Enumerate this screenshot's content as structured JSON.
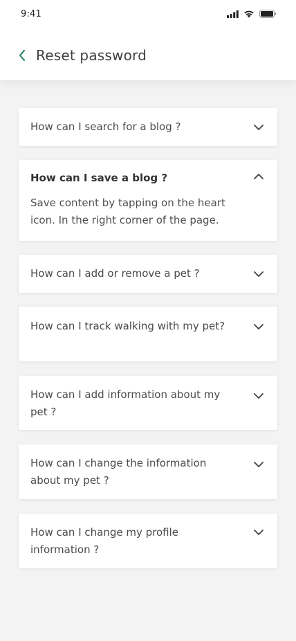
{
  "status_bar": {
    "time": "9:41",
    "icons": [
      "cellular-signal-icon",
      "wifi-icon",
      "battery-icon"
    ]
  },
  "header": {
    "back_icon": "chevron-left-icon",
    "title": "Reset password",
    "accent_color": "#3a8a6e"
  },
  "faq": {
    "items": [
      {
        "question": "How can I search for a blog ?",
        "expanded": false
      },
      {
        "question": "How can I save a blog ?",
        "expanded": true,
        "answer": "Save content by tapping on the heart icon. In the right corner of the page."
      },
      {
        "question": "How can I add or remove a pet ?",
        "expanded": false
      },
      {
        "question": "How can I track walking with my pet?",
        "expanded": false
      },
      {
        "question": "How can I add information about my pet ?",
        "expanded": false
      },
      {
        "question": "How can I change the information about my pet ?",
        "expanded": false
      },
      {
        "question": "How can I change my profile information ?",
        "expanded": false
      }
    ]
  }
}
